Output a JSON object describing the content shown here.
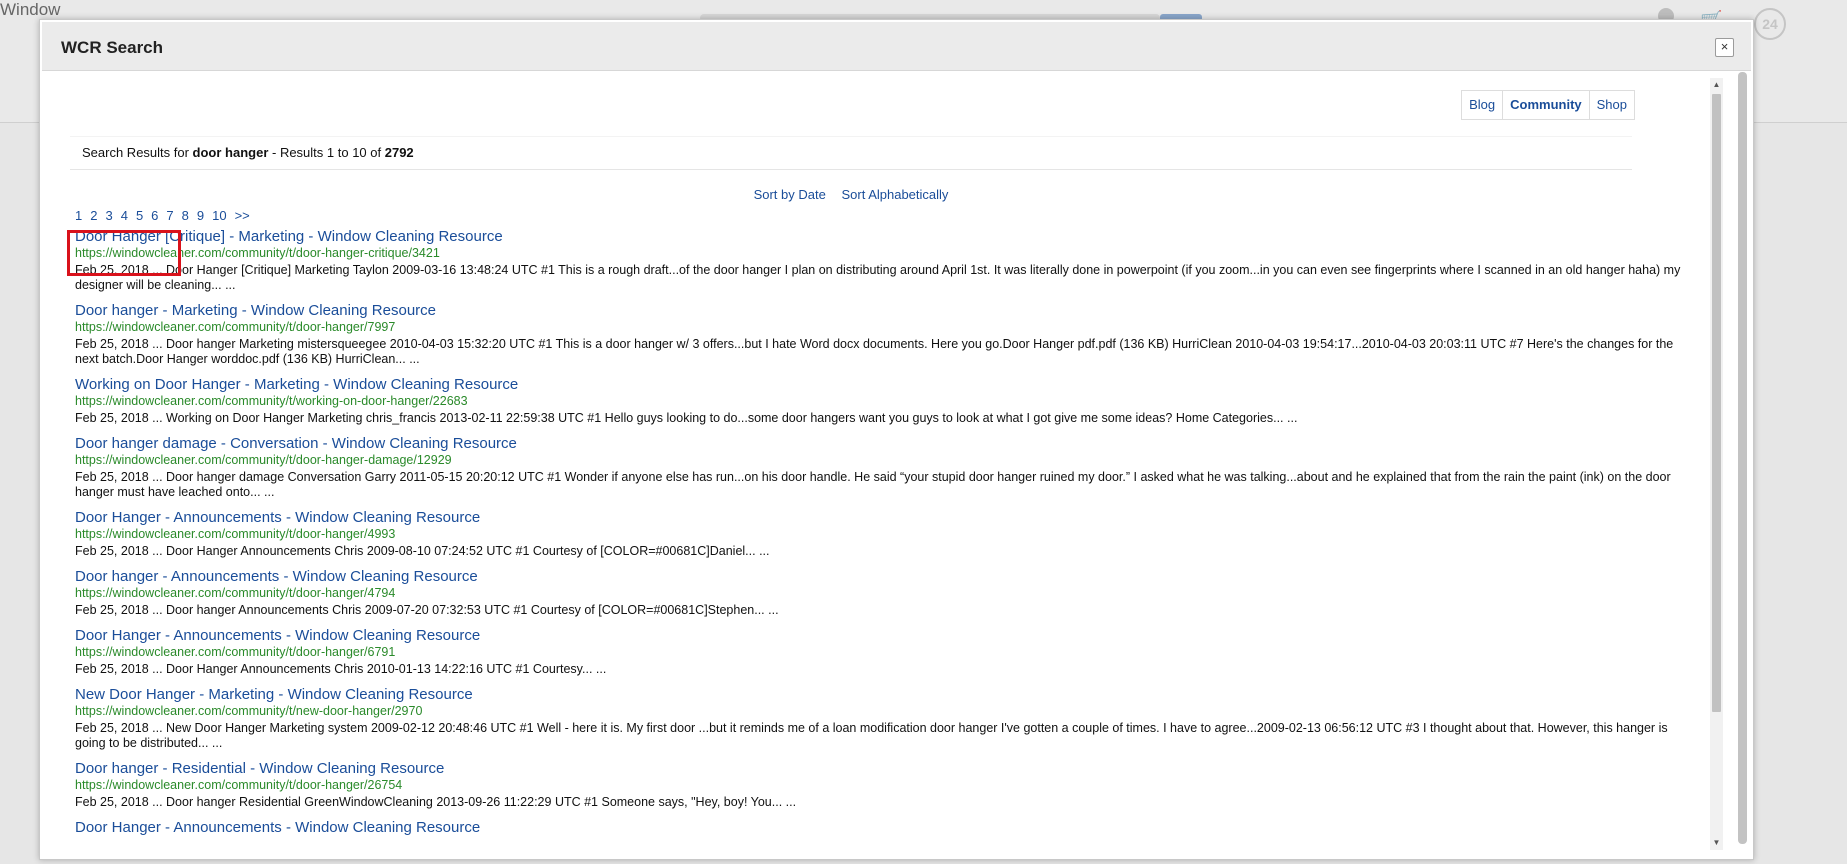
{
  "background": {
    "logo_text": "Window",
    "badge": "24"
  },
  "modal": {
    "title": "WCR Search",
    "close_label": "×"
  },
  "tabs": [
    {
      "label": "Blog",
      "active": false
    },
    {
      "label": "Community",
      "active": true
    },
    {
      "label": "Shop",
      "active": false
    }
  ],
  "summary": {
    "prefix": "Search Results for ",
    "query": "door hanger",
    "middle": " - Results 1 to 10 of ",
    "total": "2792"
  },
  "sort": {
    "by_date": "Sort by Date",
    "alphabetically": "Sort Alphabetically"
  },
  "pager": [
    "1",
    "2",
    "3",
    "4",
    "5",
    "6",
    "7",
    "8",
    "9",
    "10",
    ">>"
  ],
  "results": [
    {
      "title": "Door Hanger [Critique] - Marketing - Window Cleaning Resource",
      "url": "https://windowcleaner.com/community/t/door-hanger-critique/3421",
      "snippet": "Feb 25, 2018 ... Door Hanger [Critique] Marketing Taylon 2009-03-16 13:48:24 UTC #1 This is a rough draft...of the door hanger I plan on distributing around April 1st. It was literally done in powerpoint (if you zoom...in you can even see fingerprints where I scanned in an old hanger haha) my designer will be cleaning... ..."
    },
    {
      "title": "Door hanger - Marketing - Window Cleaning Resource",
      "url": "https://windowcleaner.com/community/t/door-hanger/7997",
      "snippet": "Feb 25, 2018 ... Door hanger Marketing mistersqueegee 2010-04-03 15:32:20 UTC #1 This is a door hanger w/ 3 offers...but I hate Word docx documents. Here you go.Door Hanger pdf.pdf (136 KB) HurriClean 2010-04-03 19:54:17...2010-04-03 20:03:11 UTC #7 Here's the changes for the next batch.Door Hanger worddoc.pdf (136 KB) HurriClean... ..."
    },
    {
      "title": "Working on Door Hanger - Marketing - Window Cleaning Resource",
      "url": "https://windowcleaner.com/community/t/working-on-door-hanger/22683",
      "snippet": "Feb 25, 2018 ... Working on Door Hanger Marketing chris_francis 2013-02-11 22:59:38 UTC #1 Hello guys looking to do...some door hangers want you guys to look at what I got give me some ideas? Home Categories... ..."
    },
    {
      "title": "Door hanger damage - Conversation - Window Cleaning Resource",
      "url": "https://windowcleaner.com/community/t/door-hanger-damage/12929",
      "snippet": "Feb 25, 2018 ... Door hanger damage Conversation Garry 2011-05-15 20:20:12 UTC #1 Wonder if anyone else has run...on his door handle. He said “your stupid door hanger ruined my door.” I asked what he was talking...about and he explained that from the rain the paint (ink) on the door hanger must have leached onto... ..."
    },
    {
      "title": "Door Hanger - Announcements - Window Cleaning Resource",
      "url": "https://windowcleaner.com/community/t/door-hanger/4993",
      "snippet": "Feb 25, 2018 ... Door Hanger Announcements Chris 2009-08-10 07:24:52 UTC #1 Courtesy of [COLOR=#00681C]Daniel... ..."
    },
    {
      "title": "Door hanger - Announcements - Window Cleaning Resource",
      "url": "https://windowcleaner.com/community/t/door-hanger/4794",
      "snippet": "Feb 25, 2018 ... Door hanger Announcements Chris 2009-07-20 07:32:53 UTC #1 Courtesy of [COLOR=#00681C]Stephen... ..."
    },
    {
      "title": "Door Hanger - Announcements - Window Cleaning Resource",
      "url": "https://windowcleaner.com/community/t/door-hanger/6791",
      "snippet": "Feb 25, 2018 ... Door Hanger Announcements Chris 2010-01-13 14:22:16 UTC #1 Courtesy... ..."
    },
    {
      "title": "New Door Hanger - Marketing - Window Cleaning Resource",
      "url": "https://windowcleaner.com/community/t/new-door-hanger/2970",
      "snippet": "Feb 25, 2018 ... New Door Hanger Marketing system 2009-02-12 20:48:46 UTC #1 Well - here it is. My first door ...but it reminds me of a loan modification door hanger I've gotten a couple of times. I have to agree...2009-02-13 06:56:12 UTC #3 I thought about that. However, this hanger is going to be distributed... ..."
    },
    {
      "title": "Door hanger - Residential - Window Cleaning Resource",
      "url": "https://windowcleaner.com/community/t/door-hanger/26754",
      "snippet": "Feb 25, 2018 ... Door hanger Residential GreenWindowCleaning 2013-09-26 11:22:29 UTC #1 Someone says, \"Hey, boy! You... ..."
    },
    {
      "title": "Door Hanger - Announcements - Window Cleaning Resource",
      "url": "",
      "snippet": ""
    }
  ],
  "colors": {
    "link": "#1a4d99",
    "url": "#2a8a2a",
    "highlight": "#d9121b"
  }
}
